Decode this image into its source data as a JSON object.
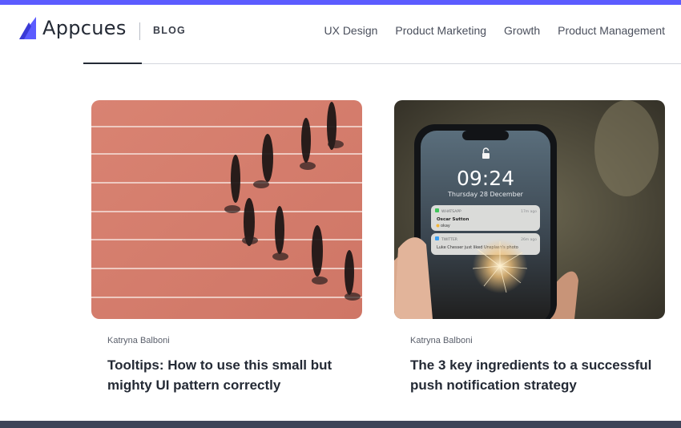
{
  "colors": {
    "accent": "#5c5cff",
    "text_dark": "#242a35",
    "footer": "#3d4458"
  },
  "header": {
    "logo_icon": "appcues-logo-icon",
    "logo_text": "Appcues",
    "section_label": "BLOG"
  },
  "nav": {
    "items": [
      {
        "label": "UX Design"
      },
      {
        "label": "Product Marketing"
      },
      {
        "label": "Growth"
      },
      {
        "label": "Product Management"
      }
    ]
  },
  "posts": [
    {
      "image": "runners-on-track-aerial-photo",
      "author": "Katryna Balboni",
      "title": "Tooltips: How to use this small but mighty UI pattern correctly"
    },
    {
      "image": "phone-lockscreen-notifications-photo",
      "author": "Katryna Balboni",
      "title": "The 3 key ingredients to a successful push notification strategy",
      "photo_text": {
        "time": "09:24",
        "date": "Thursday 28 December",
        "notif1_app": "WHATSAPP",
        "notif1_ago": "17m ago",
        "notif1_sender": "Oscar Sutton",
        "notif1_msg": "okay",
        "notif2_app": "TWITTER",
        "notif2_ago": "26m ago",
        "notif2_msg": "Luke Chesser just liked Unsplash's photo"
      }
    }
  ]
}
